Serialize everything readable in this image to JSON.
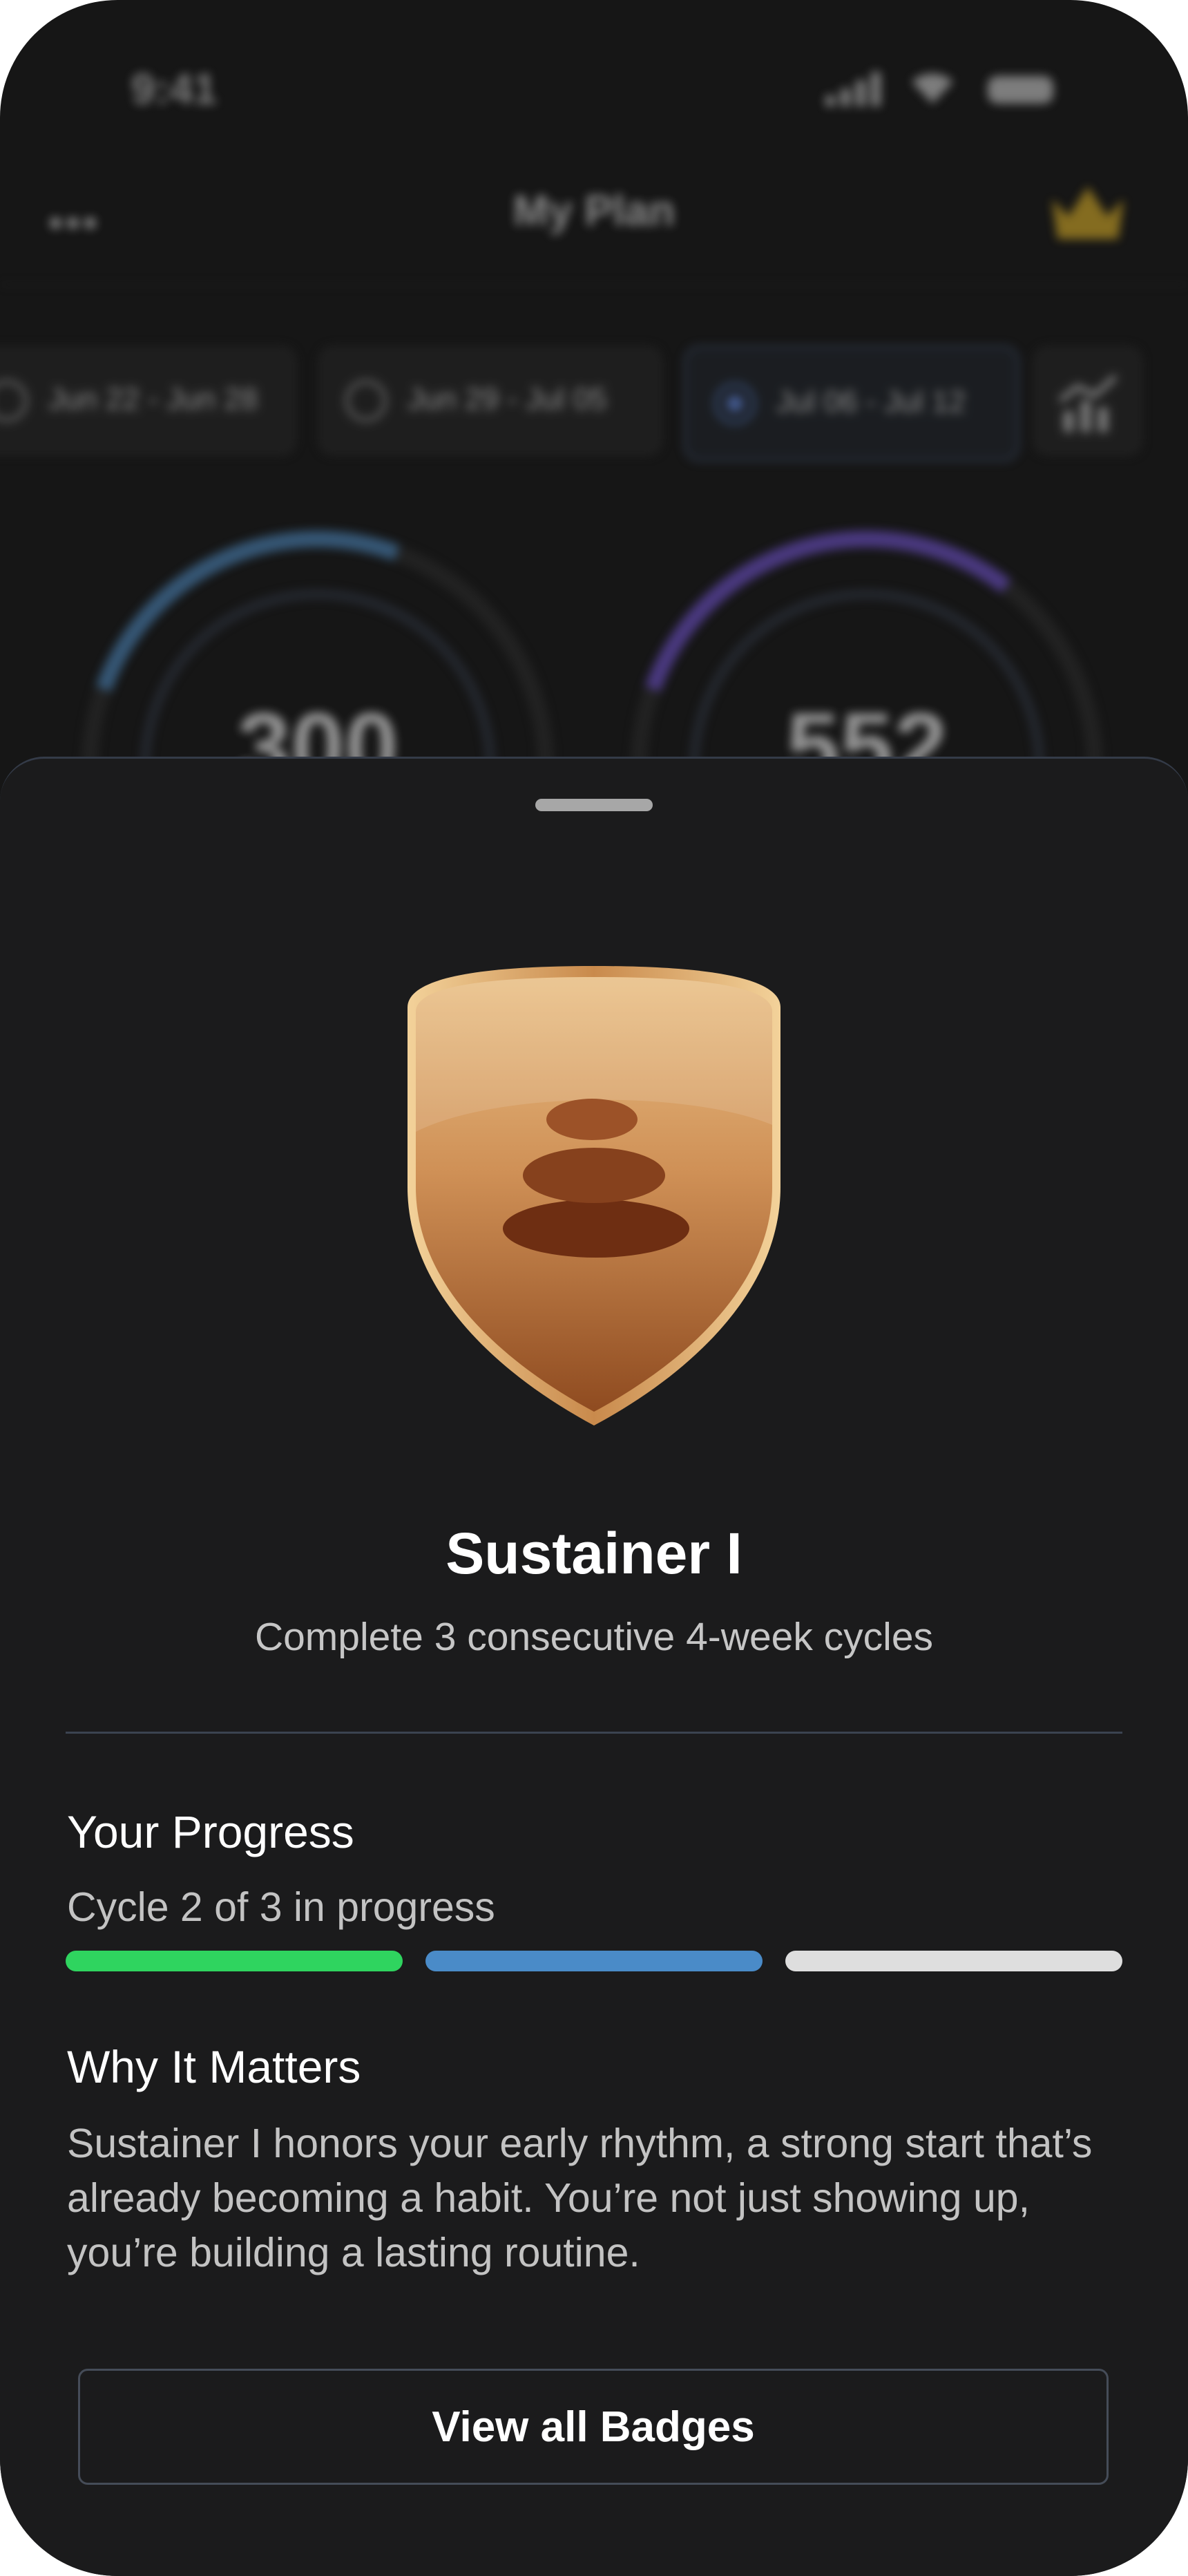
{
  "status_bar": {
    "time": "9:41"
  },
  "topbar": {
    "title": "My Plan",
    "menu_icon": "more-dots-icon",
    "premium_icon": "crown-icon"
  },
  "weeks": [
    {
      "label": "Jun 22 - Jun 28",
      "state": "completed"
    },
    {
      "label": "Jun 29 - Jul 05",
      "state": "completed"
    },
    {
      "label": "Jul 06 - Jul 12",
      "state": "current"
    }
  ],
  "rings": [
    {
      "value": "300",
      "color": "#4a7fb0"
    },
    {
      "value": "552",
      "color": "#6a4fc0"
    }
  ],
  "badge": {
    "title": "Sustainer I",
    "description": "Complete 3 consecutive 4-week cycles",
    "icon": "stacked-stones-icon"
  },
  "progress": {
    "heading": "Your Progress",
    "status": "Cycle 2 of 3 in progress",
    "segments": [
      {
        "state": "complete",
        "color": "#2fd45f"
      },
      {
        "state": "in-progress",
        "color": "#4a8bc8"
      },
      {
        "state": "pending",
        "color": "#dedede"
      }
    ]
  },
  "why": {
    "heading": "Why It Matters",
    "body": "Sustainer I honors your early rhythm, a strong start that’s already becoming a habit. You’re not just showing up, you’re building a lasting routine."
  },
  "actions": {
    "view_all": "View all Badges"
  }
}
